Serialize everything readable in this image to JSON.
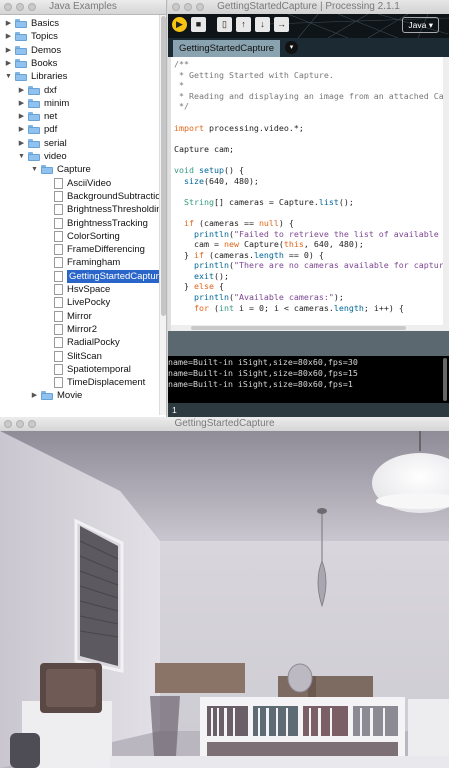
{
  "examples_window": {
    "title": "Java Examples",
    "tree": [
      {
        "label": "Basics",
        "kind": "folder",
        "depth": 0,
        "open": false
      },
      {
        "label": "Topics",
        "kind": "folder",
        "depth": 0,
        "open": false
      },
      {
        "label": "Demos",
        "kind": "folder",
        "depth": 0,
        "open": false
      },
      {
        "label": "Books",
        "kind": "folder",
        "depth": 0,
        "open": false
      },
      {
        "label": "Libraries",
        "kind": "folder",
        "depth": 0,
        "open": true
      },
      {
        "label": "dxf",
        "kind": "folder",
        "depth": 1,
        "open": false
      },
      {
        "label": "minim",
        "kind": "folder",
        "depth": 1,
        "open": false
      },
      {
        "label": "net",
        "kind": "folder",
        "depth": 1,
        "open": false
      },
      {
        "label": "pdf",
        "kind": "folder",
        "depth": 1,
        "open": false
      },
      {
        "label": "serial",
        "kind": "folder",
        "depth": 1,
        "open": false
      },
      {
        "label": "video",
        "kind": "folder",
        "depth": 1,
        "open": true
      },
      {
        "label": "Capture",
        "kind": "folder",
        "depth": 2,
        "open": true
      },
      {
        "label": "AsciiVideo",
        "kind": "file",
        "depth": 3
      },
      {
        "label": "BackgroundSubtraction",
        "kind": "file",
        "depth": 3
      },
      {
        "label": "BrightnessThresholding",
        "kind": "file",
        "depth": 3
      },
      {
        "label": "BrightnessTracking",
        "kind": "file",
        "depth": 3
      },
      {
        "label": "ColorSorting",
        "kind": "file",
        "depth": 3
      },
      {
        "label": "FrameDifferencing",
        "kind": "file",
        "depth": 3
      },
      {
        "label": "Framingham",
        "kind": "file",
        "depth": 3
      },
      {
        "label": "GettingStartedCapture",
        "kind": "file",
        "depth": 3,
        "selected": true
      },
      {
        "label": "HsvSpace",
        "kind": "file",
        "depth": 3
      },
      {
        "label": "LivePocky",
        "kind": "file",
        "depth": 3
      },
      {
        "label": "Mirror",
        "kind": "file",
        "depth": 3
      },
      {
        "label": "Mirror2",
        "kind": "file",
        "depth": 3
      },
      {
        "label": "RadialPocky",
        "kind": "file",
        "depth": 3
      },
      {
        "label": "SlitScan",
        "kind": "file",
        "depth": 3
      },
      {
        "label": "Spatiotemporal",
        "kind": "file",
        "depth": 3
      },
      {
        "label": "TimeDisplacement",
        "kind": "file",
        "depth": 3
      },
      {
        "label": "Movie",
        "kind": "folder",
        "depth": 2,
        "open": false
      }
    ]
  },
  "ide_window": {
    "title": "GettingStartedCapture | Processing 2.1.1",
    "toolbar": {
      "run": "▶",
      "stop": "■",
      "new": "▯",
      "open": "↑",
      "save": "↓",
      "export": "→"
    },
    "mode": "Java ▾",
    "tab": "GettingStartedCapture",
    "tab_menu": "▾",
    "code": [
      [
        {
          "t": "/**",
          "c": "cm"
        }
      ],
      [
        {
          "t": " * Getting Started with Capture.",
          "c": "cm"
        }
      ],
      [
        {
          "t": " *",
          "c": "cm"
        }
      ],
      [
        {
          "t": " * Reading and displaying an image from an attached Capture device.",
          "c": "cm"
        }
      ],
      [
        {
          "t": " */",
          "c": "cm"
        }
      ],
      [
        {
          "t": "",
          "c": ""
        }
      ],
      [
        {
          "t": "import",
          "c": "kw2"
        },
        {
          "t": " processing.video.*;",
          "c": ""
        }
      ],
      [
        {
          "t": "",
          "c": ""
        }
      ],
      [
        {
          "t": "Capture cam;",
          "c": ""
        }
      ],
      [
        {
          "t": "",
          "c": ""
        }
      ],
      [
        {
          "t": "void",
          "c": "kw"
        },
        {
          "t": " ",
          "c": ""
        },
        {
          "t": "setup",
          "c": "fn"
        },
        {
          "t": "() {",
          "c": ""
        }
      ],
      [
        {
          "t": "  ",
          "c": ""
        },
        {
          "t": "size",
          "c": "fn"
        },
        {
          "t": "(640, 480);",
          "c": ""
        }
      ],
      [
        {
          "t": "",
          "c": ""
        }
      ],
      [
        {
          "t": "  ",
          "c": ""
        },
        {
          "t": "String",
          "c": "kw"
        },
        {
          "t": "[] cameras = Capture.",
          "c": ""
        },
        {
          "t": "list",
          "c": "fn"
        },
        {
          "t": "();",
          "c": ""
        }
      ],
      [
        {
          "t": "",
          "c": ""
        }
      ],
      [
        {
          "t": "  ",
          "c": ""
        },
        {
          "t": "if",
          "c": "kw2"
        },
        {
          "t": " (cameras == ",
          "c": ""
        },
        {
          "t": "null",
          "c": "kw2"
        },
        {
          "t": ") {",
          "c": ""
        }
      ],
      [
        {
          "t": "    ",
          "c": ""
        },
        {
          "t": "println",
          "c": "fn"
        },
        {
          "t": "(",
          "c": ""
        },
        {
          "t": "\"Failed to retrieve the list of available cameras, will try the default...\"",
          "c": "str"
        },
        {
          "t": ");",
          "c": ""
        }
      ],
      [
        {
          "t": "    cam = ",
          "c": ""
        },
        {
          "t": "new",
          "c": "kw2"
        },
        {
          "t": " Capture(",
          "c": ""
        },
        {
          "t": "this",
          "c": "kw2"
        },
        {
          "t": ", 640, 480);",
          "c": ""
        }
      ],
      [
        {
          "t": "  } ",
          "c": ""
        },
        {
          "t": "if",
          "c": "kw2"
        },
        {
          "t": " (cameras.",
          "c": ""
        },
        {
          "t": "length",
          "c": "fn"
        },
        {
          "t": " == 0) {",
          "c": ""
        }
      ],
      [
        {
          "t": "    ",
          "c": ""
        },
        {
          "t": "println",
          "c": "fn"
        },
        {
          "t": "(",
          "c": ""
        },
        {
          "t": "\"There are no cameras available for capture.\"",
          "c": "str"
        },
        {
          "t": ");",
          "c": ""
        }
      ],
      [
        {
          "t": "    ",
          "c": ""
        },
        {
          "t": "exit",
          "c": "fn"
        },
        {
          "t": "();",
          "c": ""
        }
      ],
      [
        {
          "t": "  } ",
          "c": ""
        },
        {
          "t": "else",
          "c": "kw2"
        },
        {
          "t": " {",
          "c": ""
        }
      ],
      [
        {
          "t": "    ",
          "c": ""
        },
        {
          "t": "println",
          "c": "fn"
        },
        {
          "t": "(",
          "c": ""
        },
        {
          "t": "\"Available cameras:\"",
          "c": "str"
        },
        {
          "t": ");",
          "c": ""
        }
      ],
      [
        {
          "t": "    ",
          "c": ""
        },
        {
          "t": "for",
          "c": "kw2"
        },
        {
          "t": " (",
          "c": ""
        },
        {
          "t": "int",
          "c": "kw"
        },
        {
          "t": " i = 0; i < cameras.",
          "c": ""
        },
        {
          "t": "length",
          "c": "fn"
        },
        {
          "t": "; i++) {",
          "c": ""
        }
      ]
    ],
    "console": [
      "name=Built-in iSight,size=80x60,fps=30",
      "name=Built-in iSight,size=80x60,fps=15",
      "name=Built-in iSight,size=80x60,fps=1"
    ],
    "status_line": "1"
  },
  "capture_window": {
    "title": "GettingStartedCapture"
  }
}
